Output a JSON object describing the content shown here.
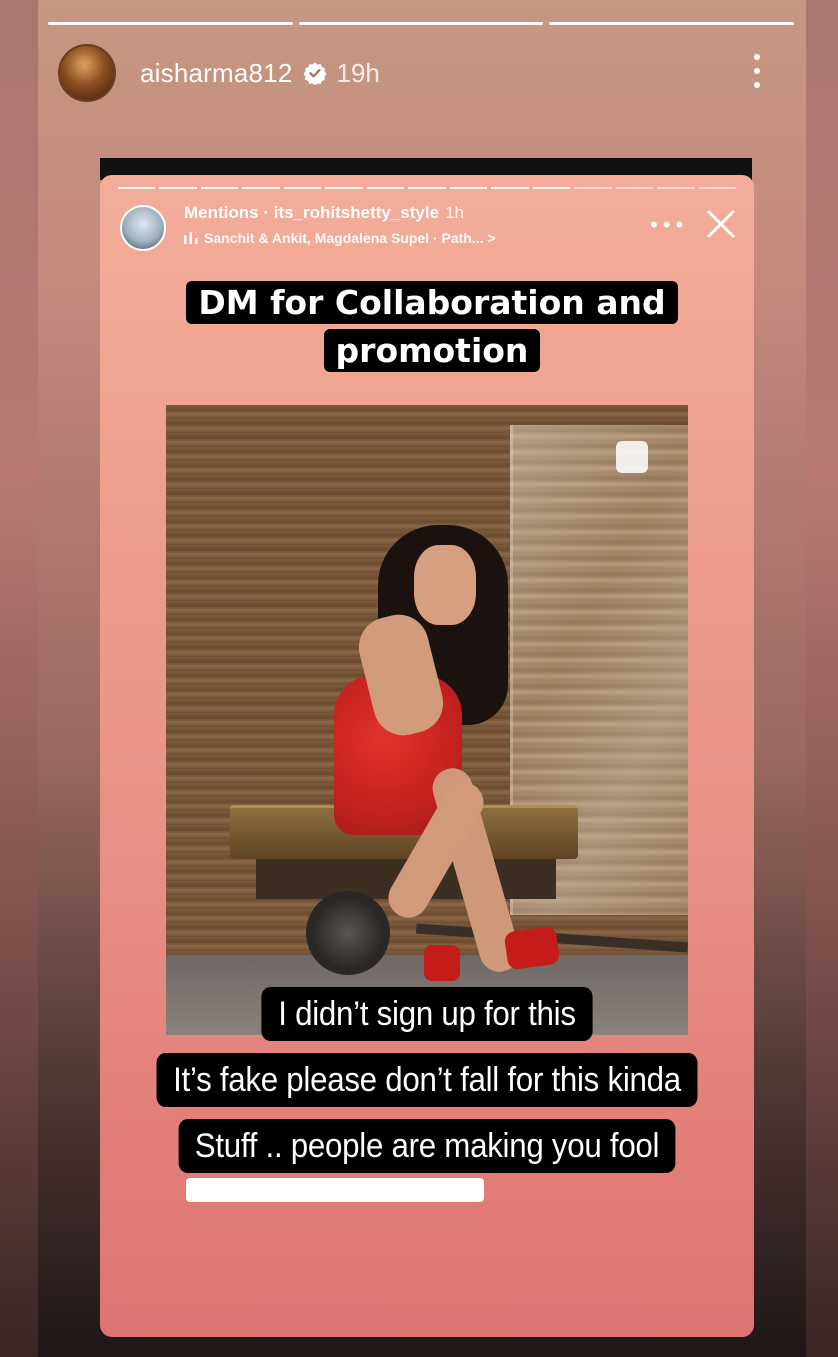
{
  "story": {
    "progress_segments": [
      true,
      true,
      false,
      false
    ],
    "username": "aisharma812",
    "verified": true,
    "time": "19h",
    "more_icon": "more-vertical-icon"
  },
  "shared_story": {
    "header_line1_bold": "Mentions · its_rohitshetty_style",
    "header_line1_time": "1h",
    "header_line2": "Sanchit & Ankit, Magdalena Supel · Path... >",
    "music_icon": "music-bars-icon",
    "more_label": "•••",
    "close_icon": "close-icon",
    "progress_segments": [
      true,
      true,
      true,
      true,
      true,
      true,
      true,
      true,
      true,
      true,
      true,
      false,
      false,
      false,
      false
    ],
    "caption_top": "DM for Collaboration and promotion",
    "caption_bottom_lines": [
      "I didn’t sign up for this",
      "It’s fake please don’t fall for this kinda",
      "Stuff .. people are making you fool"
    ]
  },
  "colors": {
    "background_top": "#c59882",
    "inner_card": "#ee9e8d",
    "sticker_bg": "#000000",
    "text": "#ffffff"
  }
}
